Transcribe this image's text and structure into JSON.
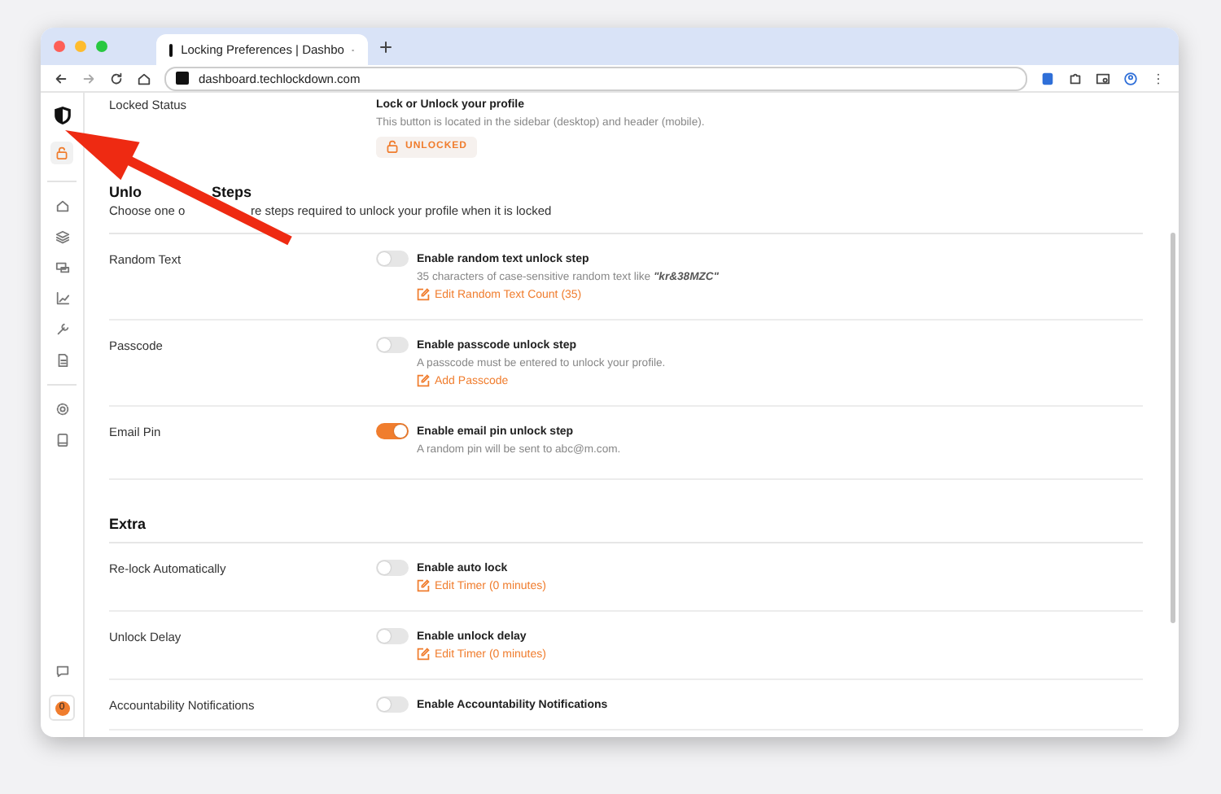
{
  "browser": {
    "tab_title": "Locking Preferences | Dashbo",
    "url": "dashboard.techlockdown.com"
  },
  "sidebar": {
    "badge": "0"
  },
  "locked_status": {
    "label": "Locked Status",
    "title": "Lock or Unlock your profile",
    "description": "This button is located in the sidebar (desktop) and header (mobile).",
    "button": "UNLOCKED"
  },
  "sections": [
    {
      "title": [
        "Unlo",
        "Steps"
      ],
      "subtitle": [
        "Choose one o",
        "re steps required to unlock your profile when it is locked"
      ],
      "rows": [
        {
          "label": "Random Text",
          "title": "Enable random text unlock step",
          "on": false,
          "description": "35 characters of case-sensitive random text like **\"kr&38MZC\"**",
          "link": "Edit Random Text Count (35)"
        },
        {
          "label": "Passcode",
          "title": "Enable passcode unlock step",
          "on": false,
          "description": "A passcode must be entered to unlock your profile.",
          "link": "Add Passcode"
        },
        {
          "label": "Email Pin",
          "title": "Enable email pin unlock step",
          "on": true,
          "description": "A random pin will be sent to abc@m.com."
        }
      ]
    },
    {
      "title": [
        "Extra"
      ],
      "rows": [
        {
          "label": "Re-lock Automatically",
          "title": "Enable auto lock",
          "on": false,
          "link": "Edit Timer (0 minutes)"
        },
        {
          "label": "Unlock Delay",
          "title": "Enable unlock delay",
          "on": false,
          "link": "Edit Timer (0 minutes)"
        },
        {
          "label": "Accountability Notifications",
          "title": "Enable Accountability Notifications",
          "on": false
        }
      ]
    }
  ]
}
